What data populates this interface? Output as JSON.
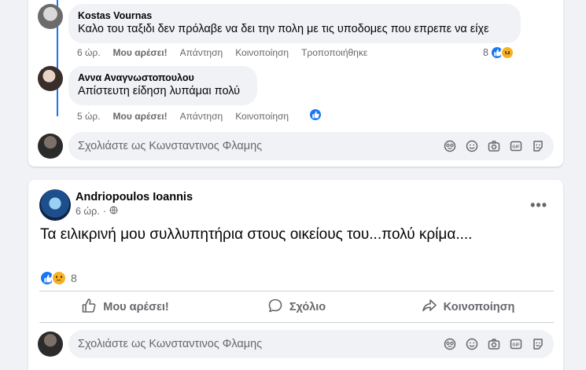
{
  "thread": {
    "comments": [
      {
        "author": "Kostas Vournas",
        "text": "Καλο του ταξιδι δεν πρόλαβε να δει την πολη με τις υποδομες που επρεπε να είχε",
        "time": "6 ώρ.",
        "like": "Μου αρέσει!",
        "reply": "Απάντηση",
        "share": "Κοινοποίηση",
        "edited": "Τροποποιήθηκε",
        "reaction_count": "8"
      },
      {
        "author": "Αννα Αναγνωστοπουλου",
        "text": "Απίστευτη είδηση λυπάμαι πολύ",
        "time": "5 ώρ.",
        "like": "Μου αρέσει!",
        "reply": "Απάντηση",
        "share": "Κοινοποίηση"
      }
    ],
    "comment_placeholder": "Σχολιάστε ως Κωνσταντινος Φλαμης"
  },
  "post": {
    "author": "Andriopoulos Ioannis",
    "time": "6 ώρ.",
    "text": "Τα ειλικρινή μου συλλυπητήρια στους οικείους του...πολύ κρίμα....",
    "reaction_count": "8",
    "actions": {
      "like": "Μου αρέσει!",
      "comment": "Σχόλιο",
      "share": "Κοινοποίηση"
    },
    "comment_placeholder": "Σχολιάστε ως Κωνσταντινος Φλαμης"
  },
  "colors": {
    "accent": "#1877f2",
    "sad": "#f7b125",
    "muted_text": "#65676b",
    "page_bg": "#f0f2f5"
  },
  "icons": [
    "like-icon",
    "sad-icon",
    "globe-icon",
    "more-icon",
    "sticker-icon",
    "emoji-icon",
    "camera-icon",
    "gif-icon",
    "avatar-sticker-icon",
    "thumbs-up-icon",
    "comment-icon",
    "share-icon"
  ]
}
